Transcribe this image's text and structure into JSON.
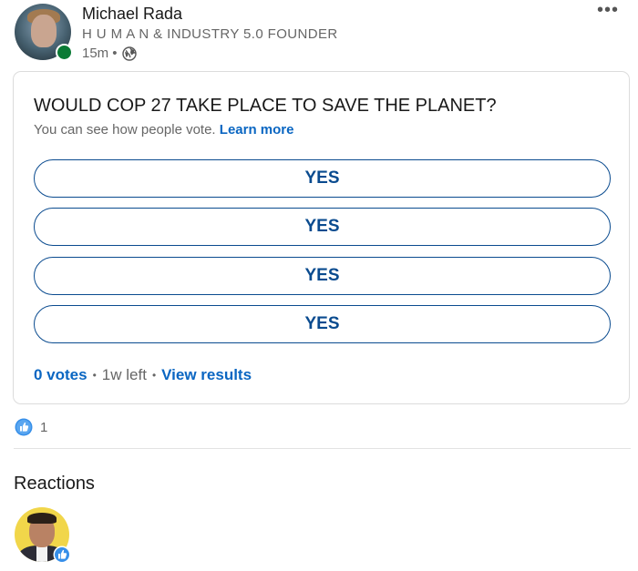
{
  "post": {
    "author_name": "Michael Rada",
    "author_headline": "H U M A N & INDUSTRY 5.0 FOUNDER",
    "time_ago": "15m",
    "meta_separator": "•",
    "visibility_icon": "globe-icon",
    "menu_icon": "more-horizontal-icon",
    "presence_status_color": "#0a7a35"
  },
  "poll": {
    "question": "WOULD COP 27 TAKE PLACE TO SAVE THE PLANET?",
    "subtext": "You can see how people vote.",
    "learn_more_label": "Learn more",
    "options": [
      {
        "label": "YES"
      },
      {
        "label": "YES"
      },
      {
        "label": "YES"
      },
      {
        "label": "YES"
      }
    ],
    "votes_label": "0 votes",
    "time_left": "1w left",
    "separator": "•",
    "view_results_label": "View results",
    "accent_color": "#0a66c2"
  },
  "social": {
    "reaction_icon": "like-icon",
    "reaction_count": "1"
  },
  "reactions": {
    "title": "Reactions",
    "reactors": [
      {
        "reaction_icon": "like-icon"
      }
    ]
  }
}
